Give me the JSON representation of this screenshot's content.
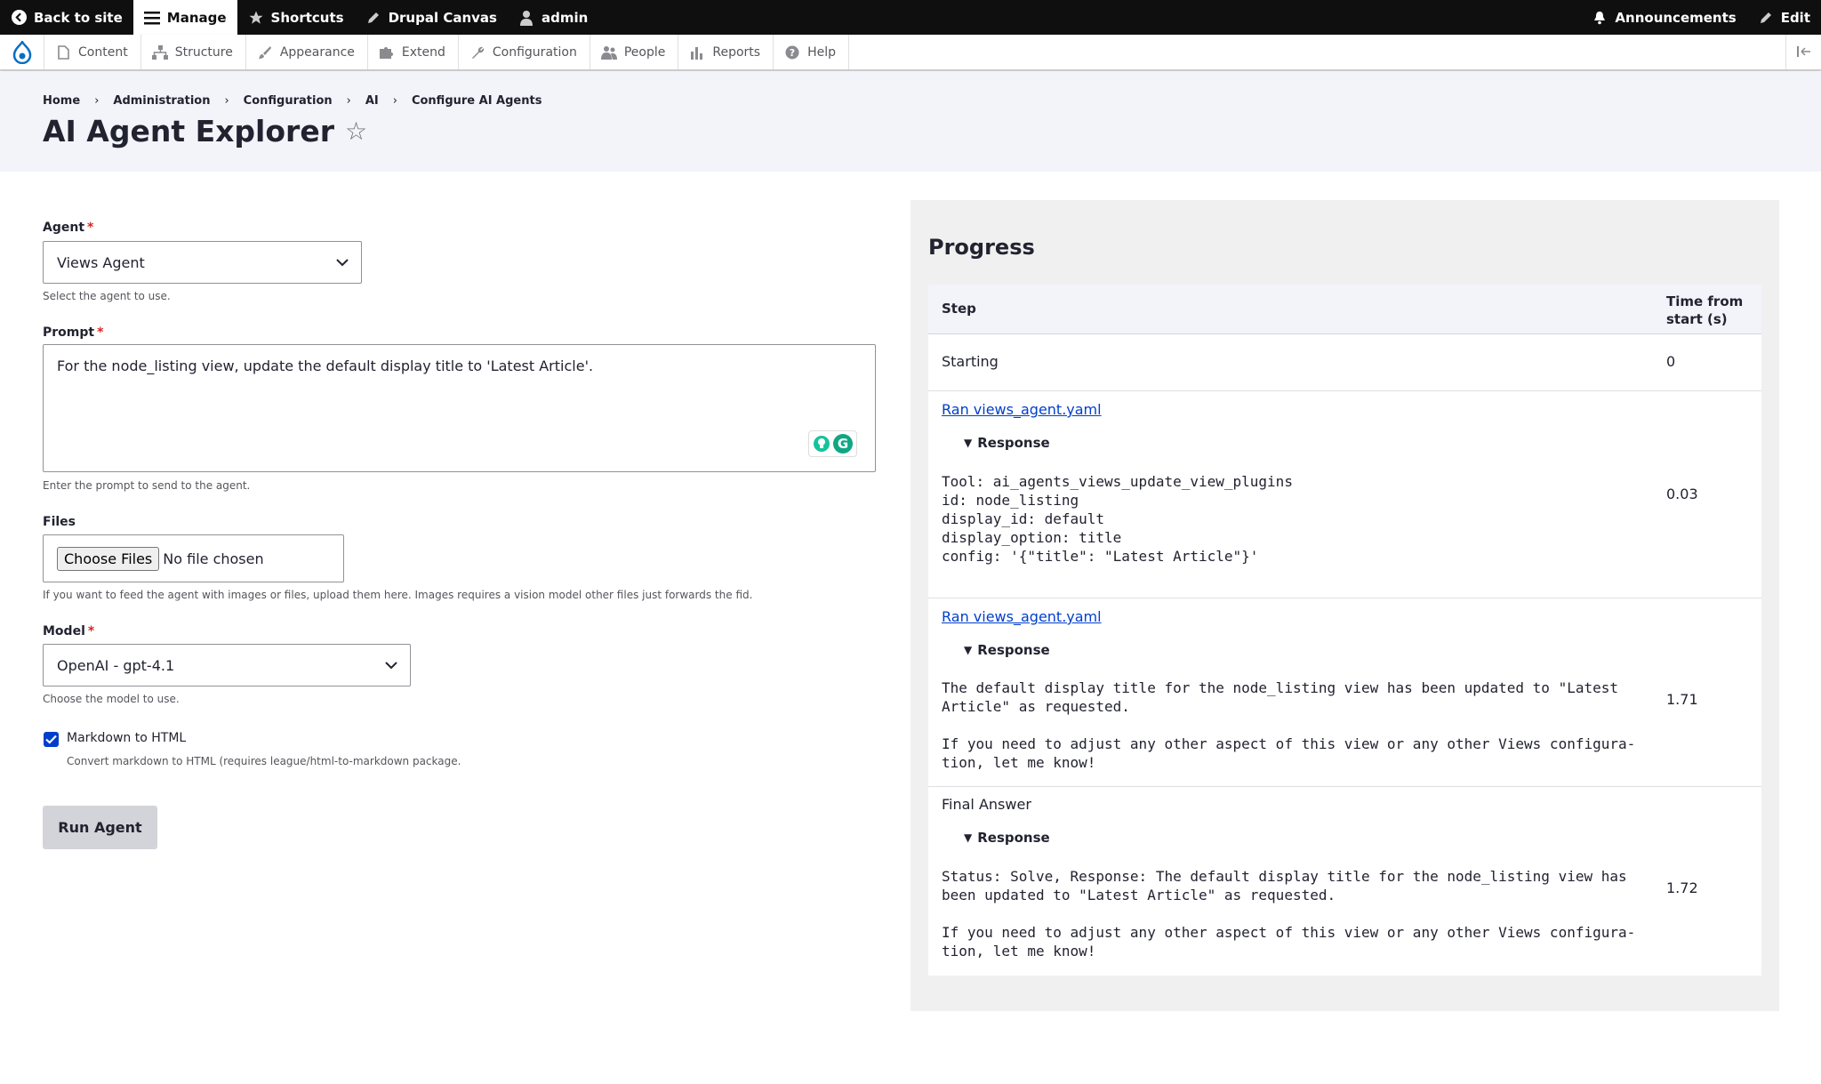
{
  "toolbar": {
    "back_to_site": "Back to site",
    "manage": "Manage",
    "shortcuts": "Shortcuts",
    "drupal_canvas": "Drupal Canvas",
    "user": "admin",
    "announcements": "Announcements",
    "edit": "Edit"
  },
  "tray": {
    "items": [
      "Content",
      "Structure",
      "Appearance",
      "Extend",
      "Configuration",
      "People",
      "Reports",
      "Help"
    ]
  },
  "breadcrumb": [
    "Home",
    "Administration",
    "Configuration",
    "AI",
    "Configure AI Agents"
  ],
  "page_title": "AI Agent Explorer",
  "form": {
    "agent_label": "Agent",
    "agent_value": "Views Agent",
    "agent_desc": "Select the agent to use.",
    "prompt_label": "Prompt",
    "prompt_value": "For the node_listing view, update the default display title to 'Latest Article'.",
    "prompt_desc": "Enter the prompt to send to the agent.",
    "files_label": "Files",
    "files_button": "Choose Files",
    "files_status": "No file chosen",
    "files_desc": "If you want to feed the agent with images or files, upload them here. Images requires a vision model other files just forwards the fid.",
    "model_label": "Model",
    "model_value": "OpenAI - gpt-4.1",
    "model_desc": "Choose the model to use.",
    "markdown_label": "Markdown to HTML",
    "markdown_checked": true,
    "markdown_desc": "Convert markdown to HTML (requires league/html-to-markdown package.",
    "run_button": "Run Agent"
  },
  "progress": {
    "title": "Progress",
    "col_step": "Step",
    "col_time": "Time from start (s)",
    "response_label": "Response",
    "rows": [
      {
        "step": "Starting",
        "time": "0"
      },
      {
        "step": "Ran views_agent.yaml",
        "time": "0.03",
        "response": "Tool: ai_agents_views_update_view_plugins\nid: node_listing\ndisplay_id: default\ndisplay_option: title\nconfig: '{\"title\": \"Latest Article\"}'"
      },
      {
        "step": "Ran views_agent.yaml",
        "time": "1.71",
        "response": "The default display title for the node_listing view has been updated to \"Latest\nArticle\" as requested.\n\nIf you need to adjust any other aspect of this view or any other Views configura-\ntion, let me know!"
      },
      {
        "step": "Final Answer",
        "time": "1.72",
        "response": "Status: Solve, Response: The default display title for the node_listing view has\nbeen updated to \"Latest Article\" as requested.\n\nIf you need to adjust any other aspect of this view or any other Views configura-\ntion, let me know!"
      }
    ]
  },
  "colors": {
    "toolbar_bg": "#0f0f0f",
    "header_bg": "#f3f4f9",
    "link": "#003ecc",
    "required": "#dc2323",
    "progress_bg": "#f0f0f0"
  }
}
